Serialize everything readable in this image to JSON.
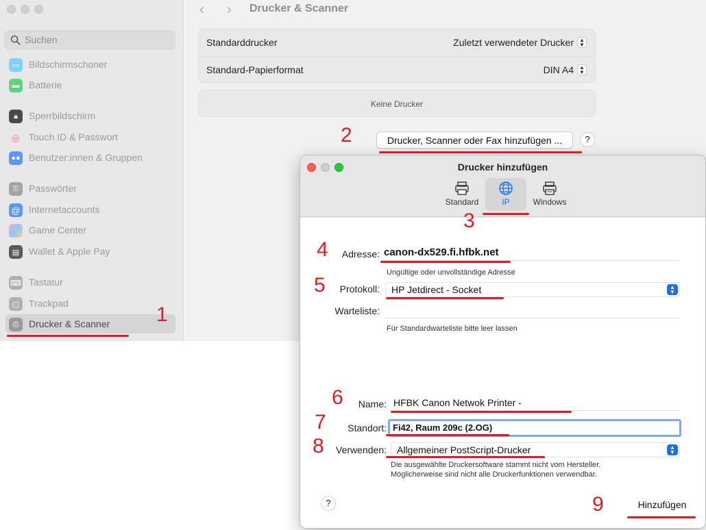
{
  "sidebar": {
    "search_placeholder": "Suchen",
    "items": [
      {
        "label": "Bildschirmschoner",
        "icon": "screensaver-icon",
        "color": "#5ac8fa"
      },
      {
        "label": "Batterie",
        "icon": "battery-icon",
        "color": "#34c759"
      },
      {
        "label": "Sperrbildschirm",
        "icon": "lock-icon",
        "color": "#3a3a3c"
      },
      {
        "label": "Touch ID & Passwort",
        "icon": "fingerprint-icon",
        "color": "#ff3b5c"
      },
      {
        "label": "Benutzer:innen & Gruppen",
        "icon": "users-icon",
        "color": "#2f7bf5"
      },
      {
        "label": "Passwörter",
        "icon": "key-icon",
        "color": "#8e8e93"
      },
      {
        "label": "Internetaccounts",
        "icon": "at-icon",
        "color": "#2f7bf5"
      },
      {
        "label": "Game Center",
        "icon": "game-center-icon",
        "color": "#d36cf5"
      },
      {
        "label": "Wallet & Apple Pay",
        "icon": "wallet-icon",
        "color": "#3a3a3c"
      },
      {
        "label": "Tastatur",
        "icon": "keyboard-icon",
        "color": "#8e8e93"
      },
      {
        "label": "Trackpad",
        "icon": "trackpad-icon",
        "color": "#8e8e93"
      },
      {
        "label": "Drucker & Scanner",
        "icon": "printer-icon",
        "color": "#8e8e93",
        "active": true
      }
    ]
  },
  "main": {
    "title": "Drucker & Scanner",
    "default_printer_label": "Standarddrucker",
    "default_printer_value": "Zuletzt verwendeter Drucker",
    "paper_label": "Standard-Papierformat",
    "paper_value": "DIN A4",
    "no_printers": "Keine Drucker",
    "add_button": "Drucker, Scanner oder Fax hinzufügen ...",
    "help": "?"
  },
  "dialog": {
    "title": "Drucker hinzufügen",
    "toolbar": [
      {
        "label": "Standard",
        "icon": "printer-icon"
      },
      {
        "label": "IP",
        "icon": "globe-icon",
        "selected": true
      },
      {
        "label": "Windows",
        "icon": "windows-printer-icon"
      }
    ],
    "address_label": "Adresse:",
    "address_value": "canon-dx529.fi.hfbk.net",
    "address_hint": "Ungültige oder unvollständige Adresse",
    "protocol_label": "Protokoll:",
    "protocol_value": "HP Jetdirect - Socket",
    "queue_label": "Warteliste:",
    "queue_value": "",
    "queue_hint": "Für Standardwarteliste bitte leer lassen",
    "name_label": "Name:",
    "name_value": "HFBK Canon Netwok Printer -",
    "location_label": "Standort:",
    "location_value": "Fi42, Raum 209c (2.OG)",
    "use_label": "Verwenden:",
    "use_value": "Allgemeiner PostScript-Drucker",
    "use_hint_1": "Die ausgewählte Druckersoftware stammt nicht vom Hersteller.",
    "use_hint_2": "Möglicherweise sind nicht alle Druckerfunktionen verwendbar.",
    "help": "?",
    "add_button": "Hinzufügen"
  },
  "annotations": {
    "color": "#e11b22",
    "steps": [
      "1",
      "2",
      "3",
      "4",
      "5",
      "6",
      "7",
      "8",
      "9"
    ]
  }
}
